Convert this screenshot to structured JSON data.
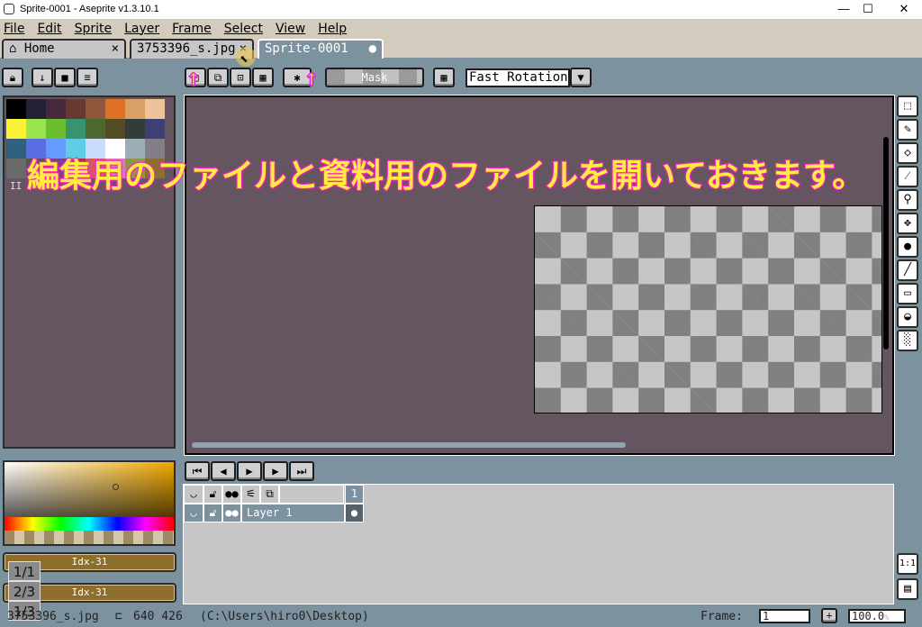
{
  "window": {
    "title": "Sprite-0001 - Aseprite v1.3.10.1",
    "minimize": "—",
    "maximize": "☐",
    "close": "✕"
  },
  "menu": [
    "File",
    "Edit",
    "Sprite",
    "Layer",
    "Frame",
    "Select",
    "View",
    "Help"
  ],
  "tabs": [
    {
      "label": "Home",
      "icon": "home-icon",
      "close": "×"
    },
    {
      "label": "3753396_s.jpg",
      "close": "×"
    },
    {
      "label": "Sprite-0001",
      "modified": "●"
    }
  ],
  "toolbar": {
    "mask_label": "Mask",
    "rotation_select": "Fast Rotation"
  },
  "palette": {
    "colors": [
      "#000000",
      "#222034",
      "#45283c",
      "#663931",
      "#8f563b",
      "#df7126",
      "#d9a066",
      "#eec39a",
      "#fbf236",
      "#99e550",
      "#6abe30",
      "#37946e",
      "#4b692f",
      "#524b24",
      "#323c39",
      "#3f3f74",
      "#306082",
      "#5b6ee1",
      "#639bff",
      "#5fcde4",
      "#cbdbfc",
      "#ffffff",
      "#9badb7",
      "#847e87",
      "#696a6a",
      "#595652",
      "#76428a",
      "#ac3232",
      "#d95763",
      "#d77bba",
      "#8f974a",
      "#8a6f30"
    ],
    "handle": "II"
  },
  "colors": {
    "fg_label": "Idx-31",
    "bg_label": "Idx-31"
  },
  "page_badges": [
    "1/1",
    "2/3",
    "1/3"
  ],
  "overlay_text": "編集用のファイルと資料用のファイルを開いておきます。",
  "timeline": {
    "frame_header": "1",
    "layers": [
      {
        "name": "Layer 1",
        "cel": "●"
      }
    ]
  },
  "status": {
    "filename": "3753396_s.jpg",
    "size": "640 426",
    "path": "(C:\\Users\\hiro0\\Desktop)",
    "frame_label": "Frame:",
    "frame_value": "1",
    "zoom": "100.0",
    "zoom_unit": "%",
    "add": "+"
  },
  "right_bottom": {
    "ratio": "1:1"
  }
}
